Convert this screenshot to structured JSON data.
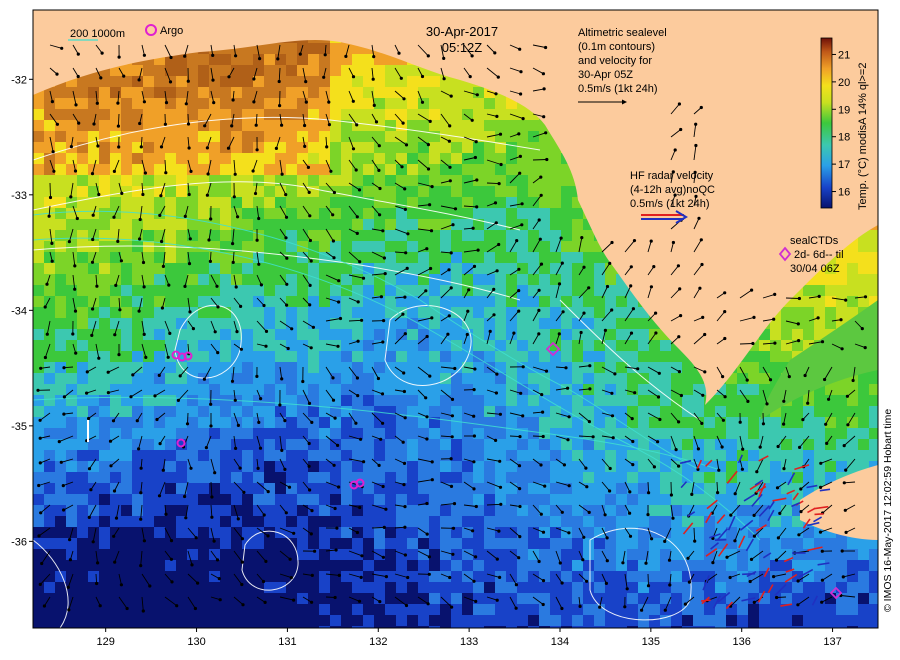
{
  "title": {
    "date": "30-Apr-2017",
    "time": "05:12Z"
  },
  "map": {
    "lon_ticks": [
      "129",
      "130",
      "131",
      "132",
      "133",
      "134",
      "135",
      "136",
      "137"
    ],
    "lat_ticks": [
      "-32",
      "-33",
      "-34",
      "-35",
      "-36"
    ],
    "lon_range": [
      128.2,
      137.5
    ],
    "lat_range": [
      -36.75,
      -31.4
    ]
  },
  "legend": {
    "isobaths": "200  1000m",
    "argo": "Argo"
  },
  "altimetry": {
    "line1": "Altimetric sealevel",
    "line2": "(0.1m contours)",
    "line3": "and velocity for",
    "line4": "30-Apr 05Z",
    "scale": "0.5m/s (1kt 24h)"
  },
  "hf_radar": {
    "line1": "HF radar velocity",
    "line2": "(4-12h avg)noQC",
    "scale": "0.5m/s (1kt 24h)"
  },
  "seal_ctd": {
    "line1": "sealCTDs",
    "line2": "2d- 6d-- til",
    "line3": "30/04 06Z"
  },
  "colorbar": {
    "label": "Temp. (°C) modisA 14% ql>=2",
    "ticks": [
      "16",
      "17",
      "18",
      "19",
      "20",
      "21"
    ],
    "range": [
      15.4,
      21.6
    ]
  },
  "credit": "© IMOS 16-May-2017 12:02:59 Hobart time",
  "colors": {
    "land": "#FCCB9D",
    "argo": "#E020D0",
    "seal": "#D030D0",
    "isobath": "#40E0D0",
    "hf_arrow_red": "#E02020",
    "hf_arrow_blue": "#2030C0"
  }
}
